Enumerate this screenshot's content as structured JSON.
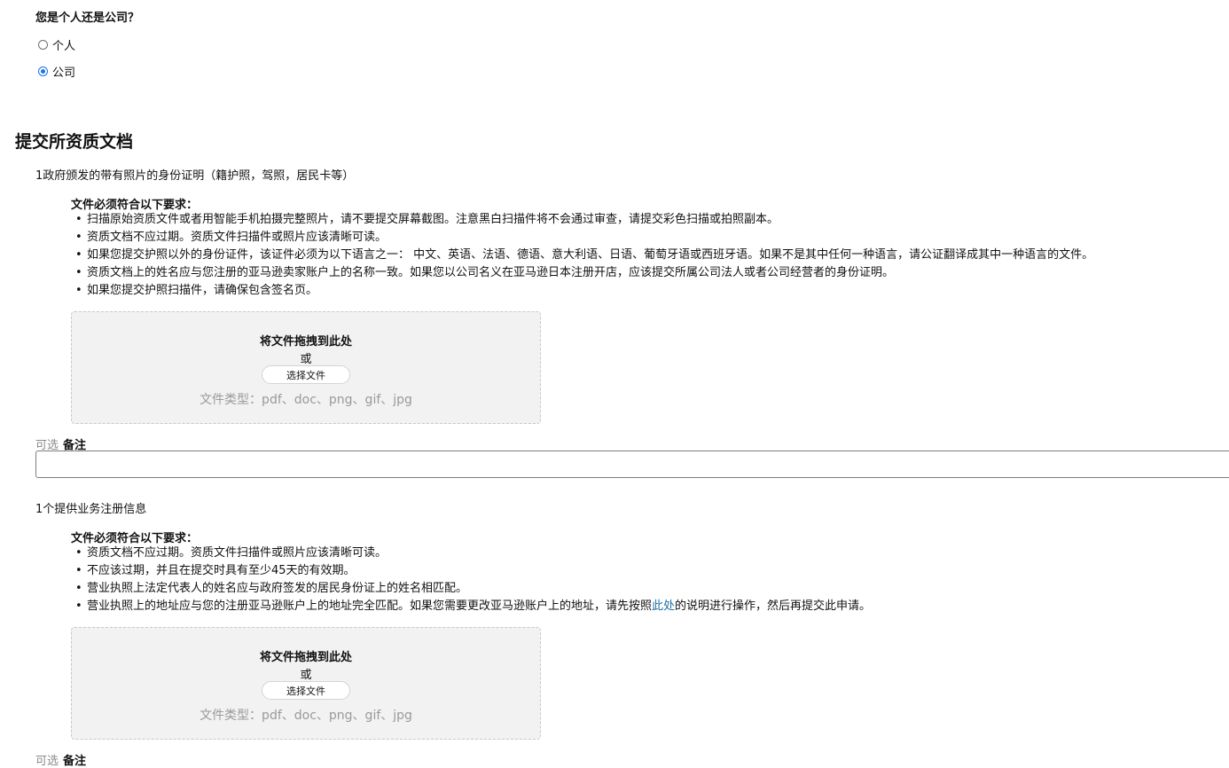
{
  "entity_question": {
    "label": "您是个人还是公司？",
    "options": [
      {
        "label": "个人",
        "selected": false
      },
      {
        "label": "公司",
        "selected": true
      }
    ]
  },
  "section_title": "提交所资质文档",
  "documents": [
    {
      "title": "1政府颁发的带有照片的身份证明（籍护照，驾照，居民卡等）",
      "requirements_heading": "文件必须符合以下要求：",
      "requirements": [
        "扫描原始资质文件或者用智能手机拍摄完整照片，请不要提交屏幕截图。注意黑白扫描件将不会通过审查，请提交彩色扫描或拍照副本。",
        "资质文档不应过期。资质文件扫描件或照片应该清晰可读。",
        "如果您提交护照以外的身份证件，该证件必须为以下语言之一： 中文、英语、法语、德语、意大利语、日语、葡萄牙语或西班牙语。如果不是其中任何一种语言，请公证翻译成其中一种语言的文件。",
        "资质文档上的姓名应与您注册的亚马逊卖家账户上的名称一致。如果您以公司名义在亚马逊日本注册开店，应该提交所属公司法人或者公司经营者的身份证明。",
        "如果您提交护照扫描件，请确保包含签名页。"
      ],
      "dropzone": {
        "drag_text": "将文件拖拽到此处",
        "or_text": "或",
        "button_label": "选择文件",
        "file_types": "文件类型：pdf、doc、png、gif、jpg"
      },
      "note": {
        "optional_label": "可选",
        "label": "备注",
        "value": ""
      }
    },
    {
      "title": "1个提供业务注册信息",
      "requirements_heading": "文件必须符合以下要求：",
      "requirements": [
        "资质文档不应过期。资质文件扫描件或照片应该清晰可读。",
        "不应该过期，并且在提交时具有至少45天的有效期。",
        "营业执照上法定代表人的姓名应与政府签发的居民身份证上的姓名相匹配。"
      ],
      "last_requirement": {
        "before": "营业执照上的地址应与您的注册亚马逊账户上的地址完全匹配。如果您需要更改亚马逊账户上的地址，请先按照",
        "link": "此处",
        "after": "的说明进行操作，然后再提交此申请。"
      },
      "dropzone": {
        "drag_text": "将文件拖拽到此处",
        "or_text": "或",
        "button_label": "选择文件",
        "file_types": "文件类型：pdf、doc、png、gif、jpg"
      },
      "note": {
        "optional_label": "可选",
        "label": "备注"
      }
    }
  ],
  "colors": {
    "accent": "#1a73e8",
    "link": "#1f6fa6",
    "dropzone_bg": "#f2f2f2",
    "muted": "#9a9a9a"
  }
}
